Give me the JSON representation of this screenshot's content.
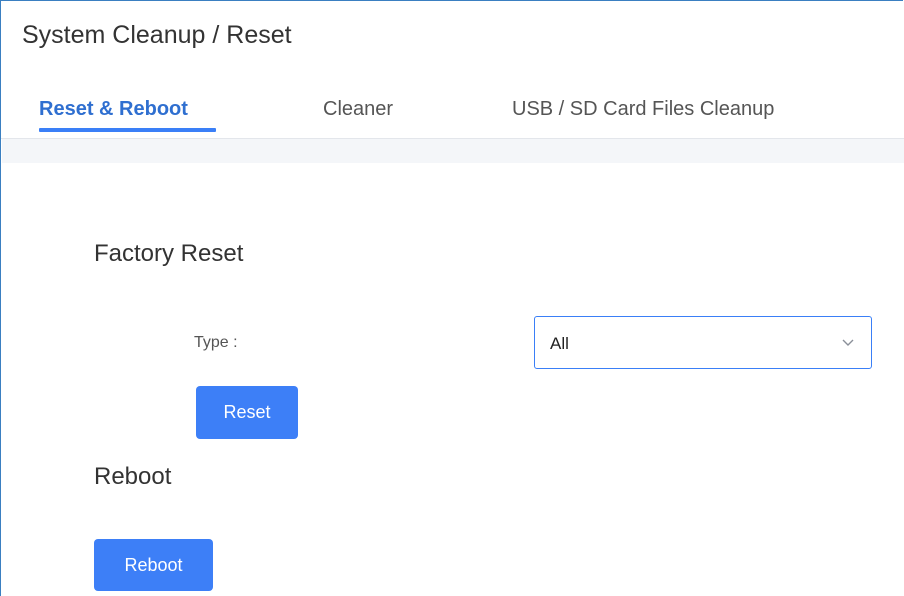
{
  "header": {
    "title": "System Cleanup / Reset"
  },
  "tabs": [
    {
      "label": "Reset & Reboot",
      "active": true
    },
    {
      "label": "Cleaner",
      "active": false
    },
    {
      "label": "USB / SD Card Files Cleanup",
      "active": false
    }
  ],
  "factory_reset": {
    "title": "Factory Reset",
    "type_label": "Type :",
    "type_value": "All",
    "button_label": "Reset"
  },
  "reboot": {
    "title": "Reboot",
    "button_label": "Reboot"
  },
  "colors": {
    "accent": "#3d7ff7",
    "active_tab_text": "#2f6fd0",
    "frame_border": "#3a7fc1",
    "band": "#f4f6f9"
  },
  "icons": {
    "select_arrow": "chevron-down-icon"
  }
}
